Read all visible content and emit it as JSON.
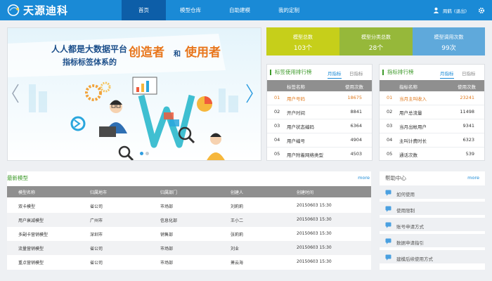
{
  "brand": {
    "name": "天源迪科"
  },
  "nav": {
    "items": [
      {
        "label": "首页",
        "active": true
      },
      {
        "label": "模型仓库",
        "active": false
      },
      {
        "label": "自助建模",
        "active": false
      },
      {
        "label": "我的定制",
        "active": false
      }
    ]
  },
  "user": {
    "name": "周鹤",
    "logout": "(退出)"
  },
  "banner": {
    "line1": "人人都是大数据平台",
    "line2": "指标标签体系的",
    "highlight1": "创造者",
    "joiner": "和",
    "highlight2": "使用者",
    "badge": "W"
  },
  "stats": [
    {
      "label": "模型总数",
      "value": "103个",
      "color": "#c6cf1a"
    },
    {
      "label": "模型分类总数",
      "value": "28个",
      "color": "#96b83a"
    },
    {
      "label": "模型调用次数",
      "value": "99次",
      "color": "#5fa9db"
    }
  ],
  "tag_ranking": {
    "title": "标签使用排行榜",
    "tabs": [
      "月指标",
      "日指标"
    ],
    "columns": [
      "标签名称",
      "使用次数"
    ],
    "rows": [
      {
        "rank": "01",
        "name": "用户号码",
        "count": "18675"
      },
      {
        "rank": "02",
        "name": "开户时间",
        "count": "8841"
      },
      {
        "rank": "03",
        "name": "用户状态编码",
        "count": "6364"
      },
      {
        "rank": "04",
        "name": "用户编号",
        "count": "4904"
      },
      {
        "rank": "05",
        "name": "用户附着网络类型",
        "count": "4503"
      }
    ]
  },
  "indicator_ranking": {
    "title": "指标排行榜",
    "tabs": [
      "月指标",
      "日指标"
    ],
    "columns": [
      "指标名称",
      "使用次数"
    ],
    "rows": [
      {
        "rank": "01",
        "name": "当月主叫收入",
        "count": "23241"
      },
      {
        "rank": "02",
        "name": "用户总流量",
        "count": "11498"
      },
      {
        "rank": "03",
        "name": "当月出帐用户",
        "count": "9341"
      },
      {
        "rank": "04",
        "name": "主叫计费时长",
        "count": "6323"
      },
      {
        "rank": "05",
        "name": "通话次数",
        "count": "539"
      }
    ]
  },
  "latest_models": {
    "title": "最新模型",
    "more": "more",
    "columns": [
      "模型名称",
      "归属地市",
      "归属部门",
      "创建人",
      "创建时间"
    ],
    "rows": [
      {
        "name": "双卡模型",
        "city": "省公司",
        "dept": "市场部",
        "creator": "刘莉莉",
        "time": "20150603 15:30"
      },
      {
        "name": "用户衰减模型",
        "city": "广州市",
        "dept": "信息化部",
        "creator": "王小二",
        "time": "20150603 15:30"
      },
      {
        "name": "多副卡营销模型",
        "city": "深圳市",
        "dept": "销售部",
        "creator": "张莉莉",
        "time": "20150603 15:30"
      },
      {
        "name": "流量营销模型",
        "city": "省公司",
        "dept": "市场部",
        "creator": "刘业",
        "time": "20150603 15:30"
      },
      {
        "name": "重点营销模型",
        "city": "省公司",
        "dept": "市场部",
        "creator": "萧云海",
        "time": "20150603 15:30"
      }
    ]
  },
  "help_center": {
    "title": "帮助中心",
    "more": "more",
    "items": [
      "如何使用",
      "使用限制",
      "账号申请方式",
      "数据申请指引",
      "建模后续使用方式"
    ]
  },
  "colors": {
    "nav_bg": "#1a8ad6",
    "nav_active": "#0d5ea8",
    "section_green": "#3d9a2a",
    "rank_first": "#e07a1e",
    "table_head": "#8f8f8f",
    "highlight_text": "#e8751a"
  }
}
